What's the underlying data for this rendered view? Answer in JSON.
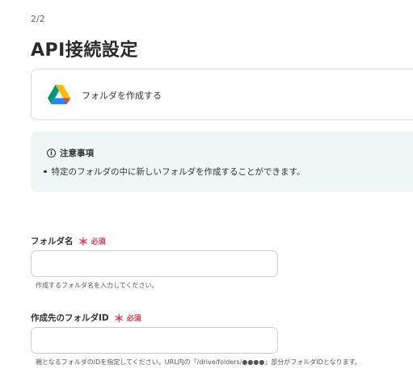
{
  "step": "2/2",
  "title": "API接続設定",
  "action": {
    "icon": "google-drive-icon",
    "label": "フォルダを作成する"
  },
  "notice": {
    "icon": "info-icon",
    "title": "注意事項",
    "items": [
      "特定のフォルダの中に新しいフォルダを作成することができます。"
    ],
    "background": "#eef6f6"
  },
  "required": {
    "mark": "＊",
    "text": "必須",
    "color": "#e0334c"
  },
  "fields": [
    {
      "label": "フォルダ名",
      "value": "",
      "hint": "作成するフォルダ名を入力してください。"
    },
    {
      "label": "作成先のフォルダID",
      "value": "",
      "hint": "親となるフォルダのIDを指定してください。URL内の「/drive/folders/●●●●」部分がフォルダIDとなります。"
    }
  ]
}
